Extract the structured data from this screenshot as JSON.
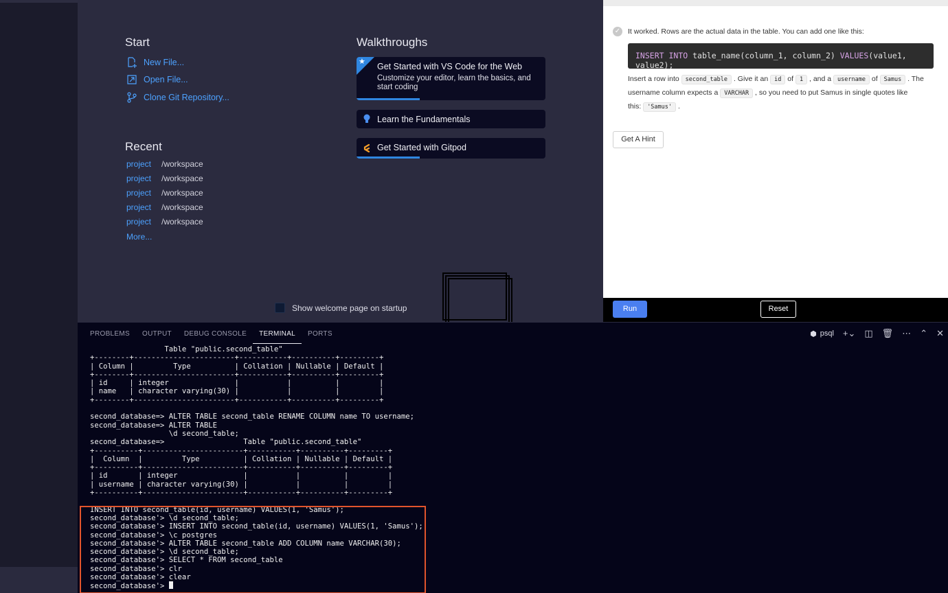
{
  "welcome": {
    "start_title": "Start",
    "start_links": [
      "New File...",
      "Open File...",
      "Clone Git Repository..."
    ],
    "recent_title": "Recent",
    "recent": [
      {
        "name": "project",
        "path": "/workspace"
      },
      {
        "name": "project",
        "path": "/workspace"
      },
      {
        "name": "project",
        "path": "/workspace"
      },
      {
        "name": "project",
        "path": "/workspace"
      },
      {
        "name": "project",
        "path": "/workspace"
      }
    ],
    "more": "More...",
    "walkthroughs_title": "Walkthroughs",
    "walk1_title": "Get Started with VS Code for the Web",
    "walk1_desc": "Customize your editor, learn the basics, and start coding",
    "walk2_title": "Learn the Fundamentals",
    "walk3_title": "Get Started with Gitpod",
    "startup_label": "Show welcome page on startup"
  },
  "panel": {
    "intro": "It worked. Rows are the actual data in the table. You can add one like this:",
    "code_kw1": "INSERT INTO",
    "code_mid": " table_name(column_1, column_2) ",
    "code_kw2": "VALUES",
    "code_end": "(value1, value2);",
    "p1": "Insert a row into",
    "c1": "second_table",
    "p2": ". Give it an",
    "c2": "id",
    "p3": "of",
    "c3": "1",
    "p4": ", and a",
    "c4": "username",
    "p5": "of",
    "c5": "Samus",
    "p6": ". The",
    "p7": "username column expects a",
    "c6": "VARCHAR",
    "p8": ", so you need to put Samus in single quotes like",
    "p9": "this:",
    "c7": "'Samus'",
    "p10": ".",
    "hint": "Get A Hint",
    "run": "Run",
    "reset": "Reset"
  },
  "terminal": {
    "tabs": [
      "PROBLEMS",
      "OUTPUT",
      "DEBUG CONSOLE",
      "TERMINAL",
      "PORTS"
    ],
    "name": "psql",
    "lines": [
      "                 Table \"public.second_table\"",
      "+--------+-----------------------+-----------+----------+---------+",
      "| Column |         Type          | Collation | Nullable | Default |",
      "+--------+-----------------------+-----------+----------+---------+",
      "| id     | integer               |           |          |         |",
      "| name   | character varying(30) |           |          |         |",
      "+--------+-----------------------+-----------+----------+---------+",
      "",
      "second_database=> ALTER TABLE second_table RENAME COLUMN name TO username;",
      "second_database=> ALTER TABLE",
      "                  \\d second_table;",
      "second_database=>                  Table \"public.second_table\"",
      "+----------+-----------------------+-----------+----------+---------+",
      "|  Column  |         Type          | Collation | Nullable | Default |",
      "+----------+-----------------------+-----------+----------+---------+",
      "| id       | integer               |           |          |         |",
      "| username | character varying(30) |           |          |         |",
      "+----------+-----------------------+-----------+----------+---------+",
      "",
      "INSERT INTO second_table(id, username) VALUES(1, 'Samus');",
      "second_database'> \\d second_table;",
      "second_database'> INSERT INTO second_table(id, username) VALUES(1, 'Samus');",
      "second_database'> \\c postgres",
      "second_database'> ALTER TABLE second_table ADD COLUMN name VARCHAR(30);",
      "second_database'> \\d second_table;",
      "second_database'> SELECT * FROM second_table",
      "second_database'> clr",
      "second_database'> clear",
      "second_database'> "
    ]
  }
}
